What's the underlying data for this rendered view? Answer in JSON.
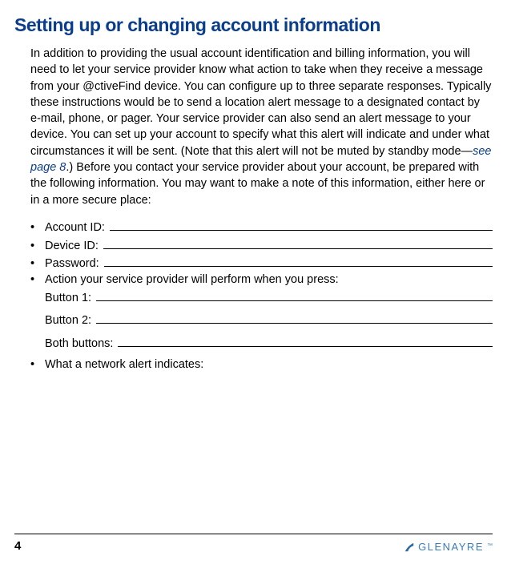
{
  "heading": "Setting up or changing account information",
  "paragraph_part1": "In addition to providing the usual account identification and billing information, you will need to let your service provider know what action to take when they receive a message from your @ctiveFind device. You can configure up to three separate responses. Typically these instructions would be to send a location alert message to a designated contact by e-mail, phone, or pager. Your service provider can also send an alert message to your device. You can set up your account to specify what this alert will indicate and under what circumstances it will be sent. (Note that this alert will not be muted by standby mode—",
  "cross_ref": "see page 8",
  "paragraph_part2": ".) Before you contact your service provider about your account, be prepared with the following information. You may want to make a note of this information, either here or in a more secure place:",
  "bullets": {
    "account_id_label": "Account ID:",
    "device_id_label": "Device ID:",
    "password_label": "Password:",
    "action_label": "Action your service provider will perform when you press:",
    "button1_label": "Button 1:",
    "button2_label": "Button 2:",
    "both_buttons_label": "Both buttons:",
    "network_alert_label": "What a network alert indicates:"
  },
  "bullet_char": "•",
  "footer": {
    "page_number": "4",
    "brand_name": "GLENAYRE",
    "trademark": "™"
  }
}
